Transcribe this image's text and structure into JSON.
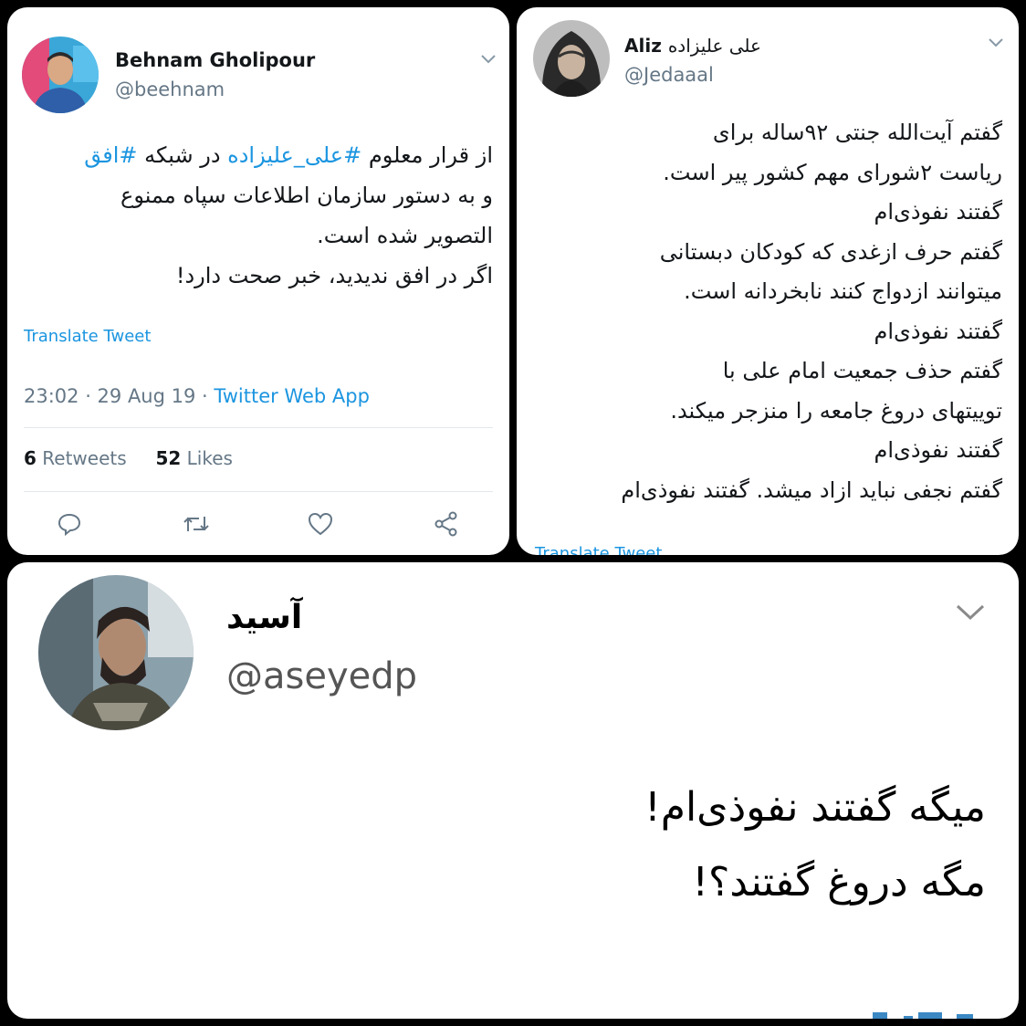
{
  "tweet1": {
    "name": "Behnam Gholipour",
    "handle": "@beehnam",
    "line1_pre": "از قرار معلوم ",
    "line1_tag1": "#علی_علیزاده",
    "line1_mid": " در شبکه ",
    "line1_tag2": "#افق",
    "line2": "و به دستور سازمان اطلاعات سپاه ممنوع",
    "line3": "التصویر شده است.",
    "line4": "اگر در افق ندیدید، خبر صحت دارد!",
    "translate": "Translate Tweet",
    "time": "23:02 · 29 Aug 19 · ",
    "source": "Twitter Web App",
    "retweets_count": "6",
    "retweets_label": " Retweets",
    "likes_count": "52",
    "likes_label": " Likes"
  },
  "tweet2": {
    "name": "Aliz",
    "name_fa": "علی علیزاده",
    "handle": "@Jedaaal",
    "lines": [
      "گفتم آیت‌الله جنتی ۹۲ساله برای",
      "ریاست ۲شورای مهم کشور پیر است.",
      "گفتند نفوذی‌ام",
      "گفتم حرف ازغدی که کودکان دبستانی",
      "میتوانند ازدواج کنند نابخردانه است.",
      "گفتند نفوذی‌ام",
      "گفتم حذف جمعیت امام علی با",
      "توییتهای دروغ جامعه را منزجر میکند.",
      "گفتند نفوذی‌ام",
      "گفتم نجفی نباید ازاد میشد. گفتند نفوذی‌ام"
    ],
    "translate": "Translate Tweet"
  },
  "tweet3": {
    "name": "آسید",
    "handle": "@aseyedp",
    "lines": [
      "میگه گفتند نفوذی‌ام!",
      "مگه دروغ گفتند؟!"
    ]
  },
  "colors": {
    "link": "#1b95e0",
    "secondary_text": "#657786",
    "background": "#000000"
  },
  "icons": [
    "chevron-down-icon",
    "reply-icon",
    "retweet-icon",
    "like-icon",
    "share-icon"
  ]
}
